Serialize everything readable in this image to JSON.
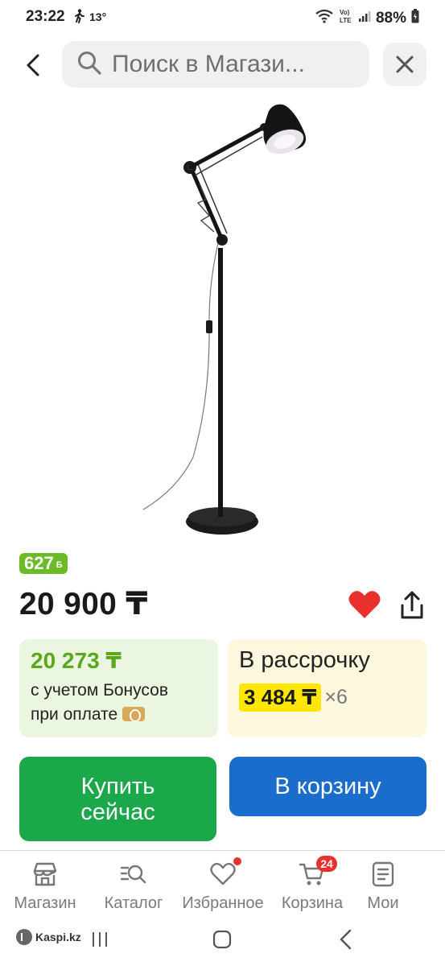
{
  "status_bar": {
    "time": "23:22",
    "temperature": "13°",
    "battery": "88%"
  },
  "search": {
    "placeholder": "Поиск в Магазине",
    "display": "Поиск в Магази..."
  },
  "product": {
    "bonus_amount": "627",
    "bonus_unit": "Б",
    "price": "20 900 ₸",
    "favorite": true
  },
  "bonus_card": {
    "price": "20 273 ₸",
    "line1": "с учетом Бонусов",
    "line2": "при оплате"
  },
  "installment_card": {
    "title": "В рассрочку",
    "amount": "3 484 ₸",
    "multiplier": "×6"
  },
  "actions": {
    "buy_now": "Купить\nсейчас",
    "add_to_cart": "В корзину"
  },
  "bottom_nav": {
    "shop": "Магазин",
    "catalog": "Каталог",
    "favorites": "Избранное",
    "cart": "Корзина",
    "cart_count": "24",
    "mine": "Мои"
  },
  "system_nav": {
    "brand": "Kaspi.kz"
  },
  "colors": {
    "green": "#1aa84a",
    "blue": "#1a6dcc",
    "bonus_green": "#6abb26",
    "yellow_highlight": "#ffe700",
    "red": "#e8312f"
  }
}
